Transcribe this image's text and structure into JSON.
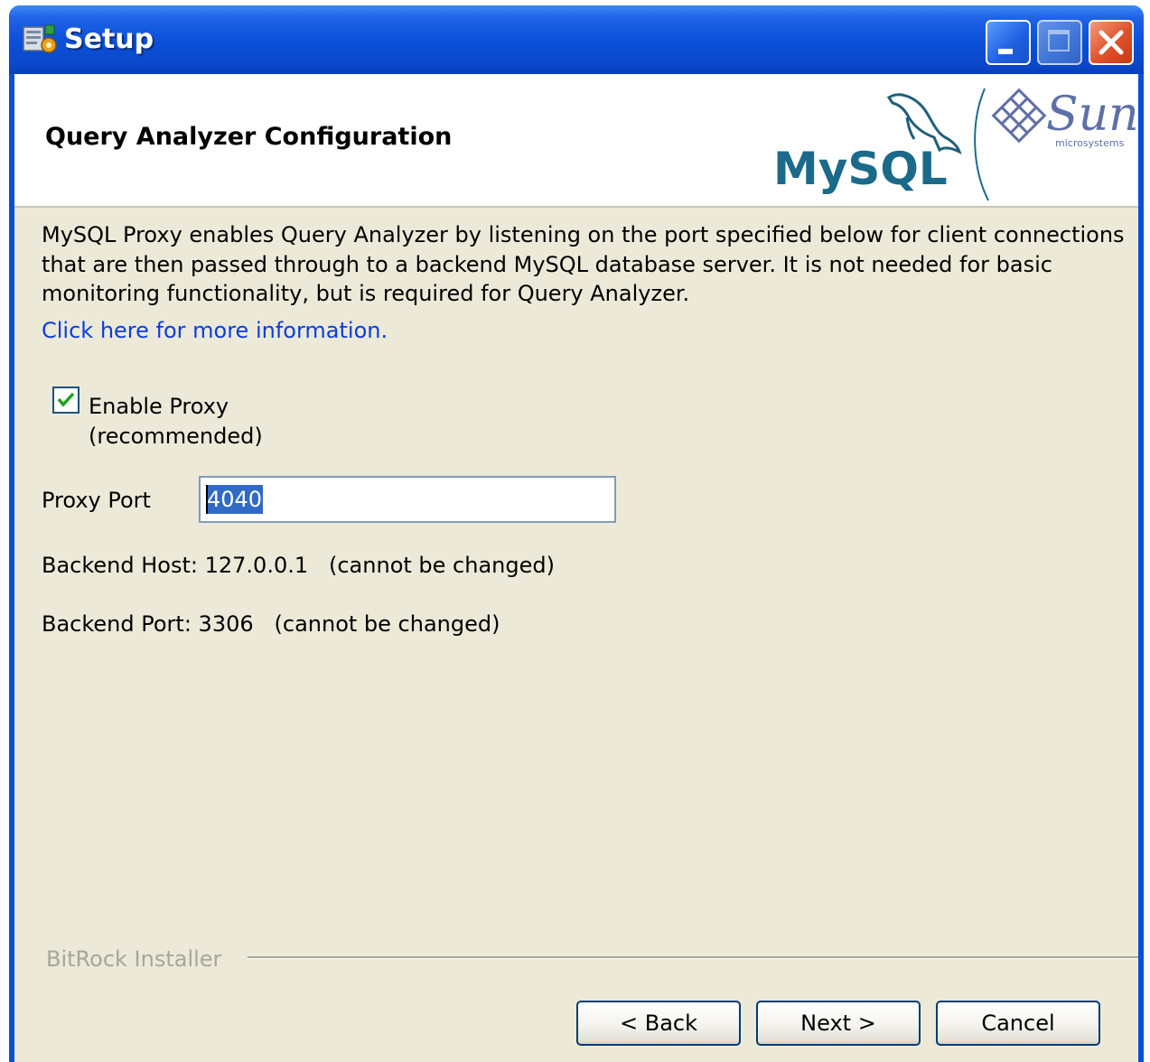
{
  "window": {
    "title": "Setup",
    "icon": "setup-app-icon",
    "controls": [
      "minimize-icon",
      "maximize-icon",
      "close-icon"
    ]
  },
  "header": {
    "title": "Query Analyzer Configuration",
    "logo_mysql": "MySQL",
    "logo_sun": "Sun",
    "logo_sun_sub": "microsystems"
  },
  "content": {
    "description": "MySQL Proxy enables Query Analyzer by listening on the port specified below for client connections that are then passed through to a backend MySQL database server. It is not needed for basic monitoring functionality, but is required for Query Analyzer.",
    "more_info_link": "Click here for more information.",
    "enable_proxy": {
      "checked": true,
      "label_line1": "Enable Proxy",
      "label_line2": "(recommended)"
    },
    "proxy_port": {
      "label": "Proxy Port",
      "value": "4040"
    },
    "backend_host": "Backend Host: 127.0.0.1   (cannot be changed)",
    "backend_port": "Backend Port: 3306   (cannot be changed)"
  },
  "footer": {
    "brand": "BitRock Installer",
    "back_label": "< Back",
    "next_label": "Next >",
    "cancel_label": "Cancel"
  },
  "colors": {
    "titlebar": "#0a4fd6",
    "dialog_bg": "#ece9d8",
    "link": "#0a3de0",
    "selection": "#316ac5"
  }
}
